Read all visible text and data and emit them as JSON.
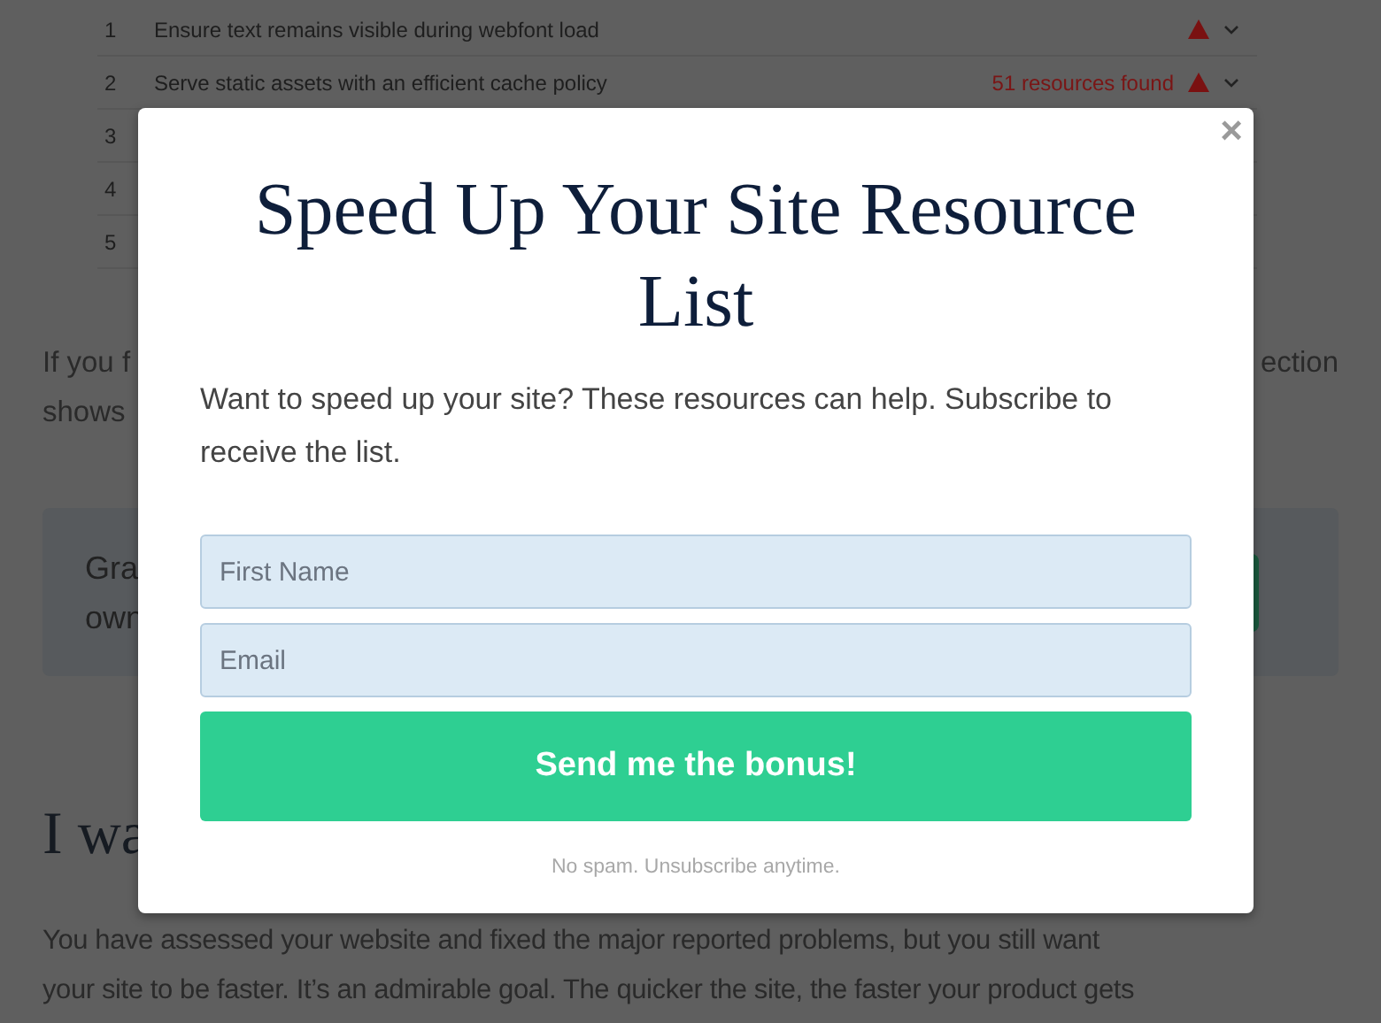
{
  "audit_table": {
    "rows": [
      {
        "number": "1",
        "audit": "Ensure text remains visible during webfont load"
      },
      {
        "number": "2",
        "audit": "Serve static assets with an efficient cache policy",
        "result": "51 resources found"
      },
      {
        "number": "3"
      },
      {
        "number": "4"
      },
      {
        "number": "5"
      }
    ]
  },
  "intro_paragraph": {
    "lines": [
      {
        "left": "If you f",
        "right": "ection"
      },
      {
        "left": "shows"
      }
    ]
  },
  "callout": {
    "lines": [
      "Gra",
      "own"
    ]
  },
  "section_heading": "I wa",
  "body_paragraph": {
    "lines": [
      "You have assessed your website and fixed the major reported problems, but you still want",
      "your site to be faster. It’s an admirable goal. The quicker the site, the faster your product gets"
    ]
  },
  "modal": {
    "title": "Speed Up Your Site Resource List",
    "description": "Want to speed up your site? These resources can help. Subscribe to receive the list.",
    "fields": [
      {
        "placeholder": "First Name"
      },
      {
        "placeholder": "Email"
      }
    ],
    "submit": "Send me the bonus!",
    "footnote": "No spam. Unsubscribe anytime.",
    "close": "×"
  }
}
